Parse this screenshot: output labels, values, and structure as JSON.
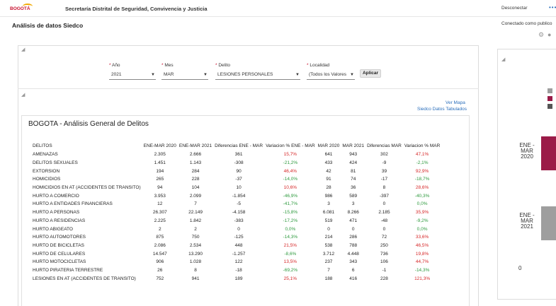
{
  "header": {
    "logo_text": "BOGOTÁ",
    "org_name": "Secretaría Distrital de Seguridad, Convivencia y Justicia",
    "disconnect_label": "Desconectar",
    "menu_dots": "•••",
    "page_title": "Análisis de datos Siedco",
    "connected_as": "Conectado como publico"
  },
  "icons": {
    "gear": "gear-icon",
    "help": "help-icon",
    "collapse": "collapse-triangle-icon"
  },
  "prompts": {
    "anio": {
      "label": "Año",
      "value": "2021"
    },
    "mes": {
      "label": "Mes",
      "value": "MAR"
    },
    "delito": {
      "label": "Delito",
      "value": "LESIONES PERSONALES"
    },
    "localidad": {
      "label": "Localidad",
      "value": "(Todos los Valores"
    },
    "apply_label": "Aplicar",
    "required_mark": "*"
  },
  "links": {
    "ver_mapa": "Ver Mapa",
    "siedco_tabulados": "Siedco Datos Tabulados"
  },
  "report": {
    "title": "BOGOTA - Análisis General de Delitos",
    "columns": [
      "DELITOS",
      "ENE-MAR 2020",
      "ENE-MAR 2021",
      "Diferencias ENE - MAR",
      "Variacion % ENE - MAR",
      "MAR 2020",
      "MAR 2021",
      "Diferencias MAR",
      "Variacion % MAR"
    ],
    "rows": [
      [
        "AMENAZAS",
        "2.305",
        "2.666",
        "361",
        "15,7%",
        "641",
        "943",
        "302",
        "47,1%"
      ],
      [
        "DELITOS SEXUALES",
        "1.451",
        "1.143",
        "-308",
        "-21,2%",
        "433",
        "424",
        "-9",
        "-2,1%"
      ],
      [
        "EXTORSION",
        "194",
        "284",
        "90",
        "46,4%",
        "42",
        "81",
        "39",
        "92,9%"
      ],
      [
        "HOMICIDIOS",
        "265",
        "228",
        "-37",
        "-14,0%",
        "91",
        "74",
        "-17",
        "-18,7%"
      ],
      [
        "HOMICIDIOS EN AT (ACCIDENTES DE TRANSITO)",
        "94",
        "104",
        "10",
        "10,6%",
        "28",
        "36",
        "8",
        "28,6%"
      ],
      [
        "HURTO A COMERCIO",
        "3.953",
        "2.099",
        "-1.854",
        "-46,9%",
        "986",
        "589",
        "-397",
        "-40,3%"
      ],
      [
        "HURTO A ENTIDADES FINANCIERAS",
        "12",
        "7",
        "-5",
        "-41,7%",
        "3",
        "3",
        "0",
        "0,0%"
      ],
      [
        "HURTO A PERSONAS",
        "26.307",
        "22.149",
        "-4.158",
        "-15,8%",
        "6.081",
        "8.266",
        "2.185",
        "35,9%"
      ],
      [
        "HURTO A RESIDENCIAS",
        "2.225",
        "1.842",
        "-383",
        "-17,2%",
        "519",
        "471",
        "-48",
        "-9,2%"
      ],
      [
        "HURTO ABIGEATO",
        "2",
        "2",
        "0",
        "0,0%",
        "0",
        "0",
        "0",
        "0,0%"
      ],
      [
        "HURTO AUTOMOTORES",
        "875",
        "750",
        "-125",
        "-14,3%",
        "214",
        "286",
        "72",
        "33,6%"
      ],
      [
        "HURTO DE BICICLETAS",
        "2.086",
        "2.534",
        "448",
        "21,5%",
        "538",
        "788",
        "250",
        "46,5%"
      ],
      [
        "HURTO DE CELULARES",
        "14.547",
        "13.290",
        "-1.257",
        "-8,6%",
        "3.712",
        "4.448",
        "736",
        "19,8%"
      ],
      [
        "HURTO MOTOCICLETAS",
        "906",
        "1.028",
        "122",
        "13,5%",
        "237",
        "343",
        "106",
        "44,7%"
      ],
      [
        "HURTO PIRATERIA TERRESTRE",
        "26",
        "8",
        "-18",
        "-69,2%",
        "7",
        "6",
        "-1",
        "-14,3%"
      ],
      [
        "LESIONES EN AT (ACCIDENTES DE TRANSITO)",
        "752",
        "941",
        "189",
        "25,1%",
        "188",
        "416",
        "228",
        "121,3%"
      ]
    ],
    "var_color_positive": "#d62728",
    "var_color_negative": "#2e9a3e"
  },
  "chart_data": {
    "type": "bar",
    "orientation": "horizontal",
    "categories": [
      "ENE - MAR 2020",
      "ENE - MAR 2021"
    ],
    "category_lines": [
      [
        "ENE -",
        "MAR",
        "2020"
      ],
      [
        "ENE -",
        "MAR",
        "2021"
      ]
    ],
    "x_tick_visible": "0",
    "legend_colors": [
      "#9e9e9e",
      "#9b1b48",
      "#555555"
    ],
    "bar_colors": [
      "#9b1b48",
      "#9e9e9e"
    ]
  }
}
